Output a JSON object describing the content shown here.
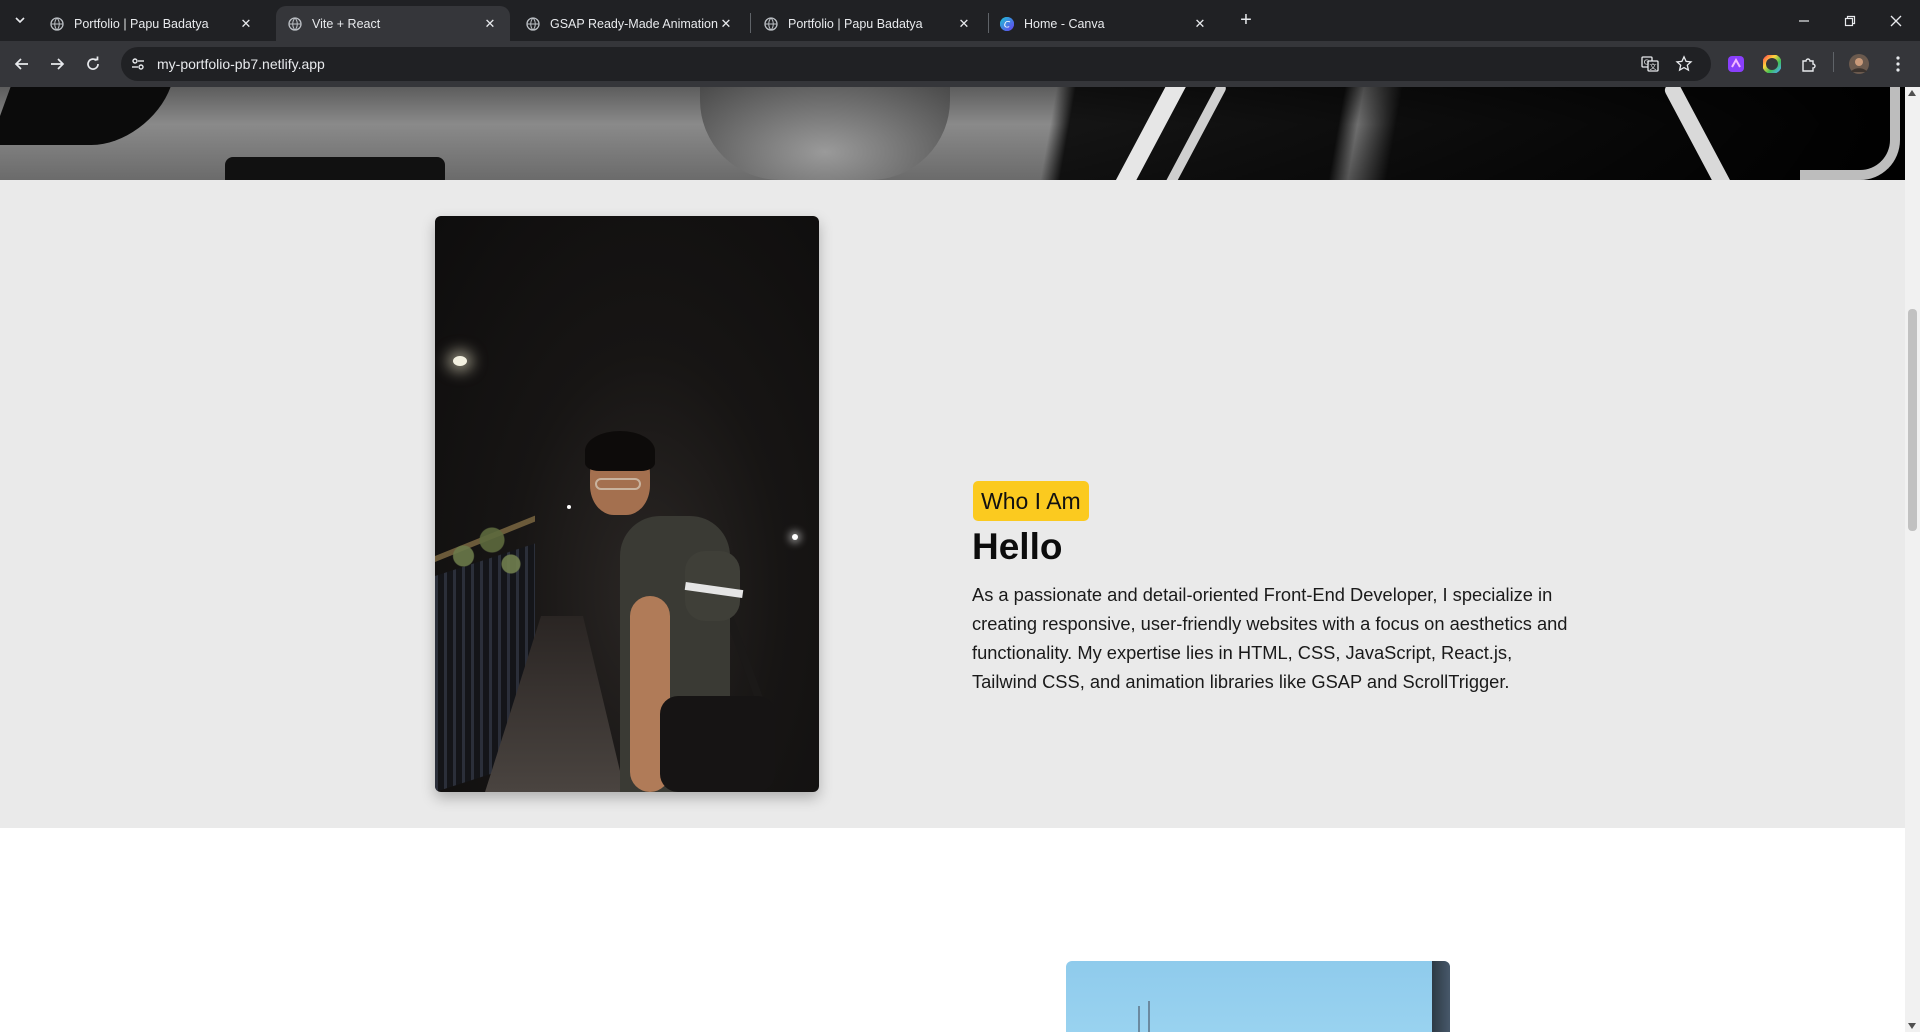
{
  "browser": {
    "tabs": [
      {
        "title": "Portfolio | Papu Badatya",
        "icon": "globe-icon",
        "active": false
      },
      {
        "title": "Vite + React",
        "icon": "globe-icon",
        "active": true
      },
      {
        "title": "GSAP Ready-Made Animations",
        "icon": "globe-icon",
        "active": false
      },
      {
        "title": "Portfolio | Papu Badatya",
        "icon": "globe-icon",
        "active": false
      },
      {
        "title": "Home - Canva",
        "icon": "canva-icon",
        "active": false
      }
    ],
    "url": "my-portfolio-pb7.netlify.app"
  },
  "about": {
    "badge": "Who I Am",
    "heading": "Hello",
    "body": "As a passionate and detail-oriented Front-End Developer, I specialize in creating responsive, user-friendly websites with a focus on aesthetics and functionality. My expertise lies in HTML, CSS, JavaScript, React.js, Tailwind CSS, and animation libraries like GSAP and ScrollTrigger.",
    "badge_color": "#fbca1f",
    "section_bg": "#eaeaea"
  }
}
